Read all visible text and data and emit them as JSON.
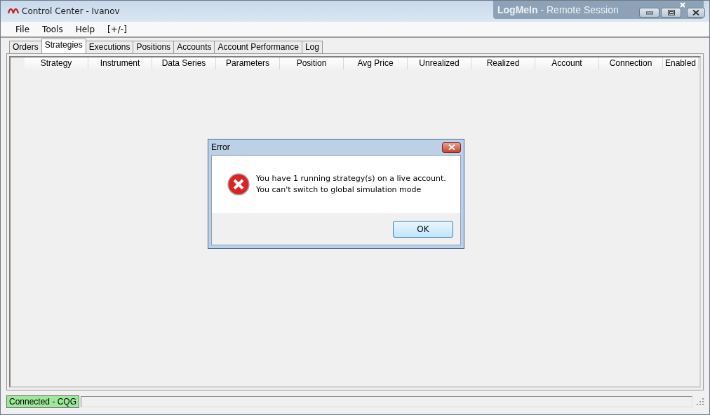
{
  "window": {
    "title": "Control Center - Ivanov"
  },
  "remote_session": {
    "brand": "LogMeIn",
    "title": "- Remote Session"
  },
  "menu": [
    "File",
    "Tools",
    "Help",
    "[+/-]"
  ],
  "tabs": [
    {
      "label": "Orders",
      "selected": false
    },
    {
      "label": "Strategies",
      "selected": true
    },
    {
      "label": "Executions",
      "selected": false
    },
    {
      "label": "Positions",
      "selected": false
    },
    {
      "label": "Accounts",
      "selected": false
    },
    {
      "label": "Account Performance",
      "selected": false
    },
    {
      "label": "Log",
      "selected": false
    }
  ],
  "table": {
    "columns": [
      "Strategy",
      "Instrument",
      "Data Series",
      "Parameters",
      "Position",
      "Avg Price",
      "Unrealized",
      "Realized",
      "Account",
      "Connection",
      "Enabled"
    ]
  },
  "dialog": {
    "title": "Error",
    "message": [
      "You have 1 running strategy(s) on a live account.",
      "You can't switch to global simulation mode"
    ],
    "button": "OK"
  },
  "status_bar": {
    "connection": "Connected - CQG"
  }
}
